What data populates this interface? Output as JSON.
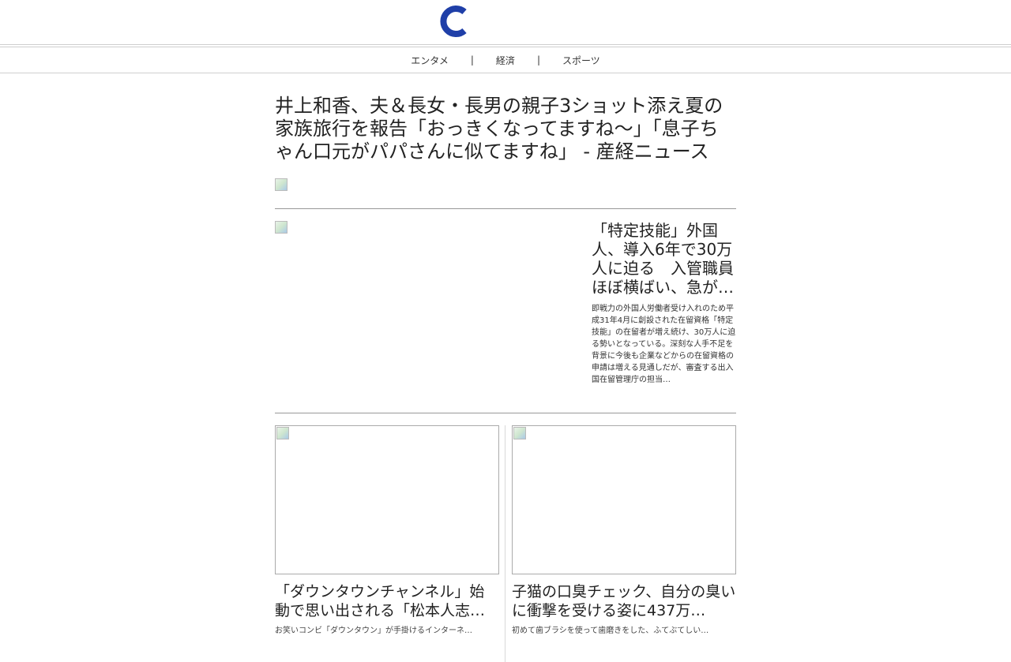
{
  "site": {
    "logo_icon": "c-logo-icon",
    "logo_color": "#1f3fa8"
  },
  "nav": {
    "items": [
      {
        "label": "エンタメ"
      },
      {
        "label": "経済"
      },
      {
        "label": "スポーツ"
      }
    ],
    "separator": "|"
  },
  "lead": {
    "title": "井上和香、夫＆長女・長男の親子3ショット添え夏の家族旅行を報告「おっきくなってますね〜」「息子ちゃん口元がパパさんに似てますね」 - 産経ニュース"
  },
  "story2": {
    "title": "「特定技能」外国人、導入6年で30万人に迫る　入管職員ほぼ横ばい、急が…",
    "summary": "即戦力の外国人労働者受け入れのため平成31年4月に創設された在留資格「特定技能」の在留者が増え続け、30万人に迫る勢いとなっている。深刻な人手不足を背景に今後も企業などからの在留資格の申請は増える見通しだが、審査する出入国在留管理庁の担当…"
  },
  "cards": [
    {
      "title": "「ダウンタウンチャンネル」始動で思い出される「松本人志…",
      "summary": "お笑いコンビ「ダウンタウン」が手掛けるインターネ…"
    },
    {
      "title": "子猫の口臭チェック、自分の臭いに衝撃を受ける姿に437万…",
      "summary": "初めて歯ブラシを使って歯磨きをした、ふてぶてしい…"
    }
  ]
}
